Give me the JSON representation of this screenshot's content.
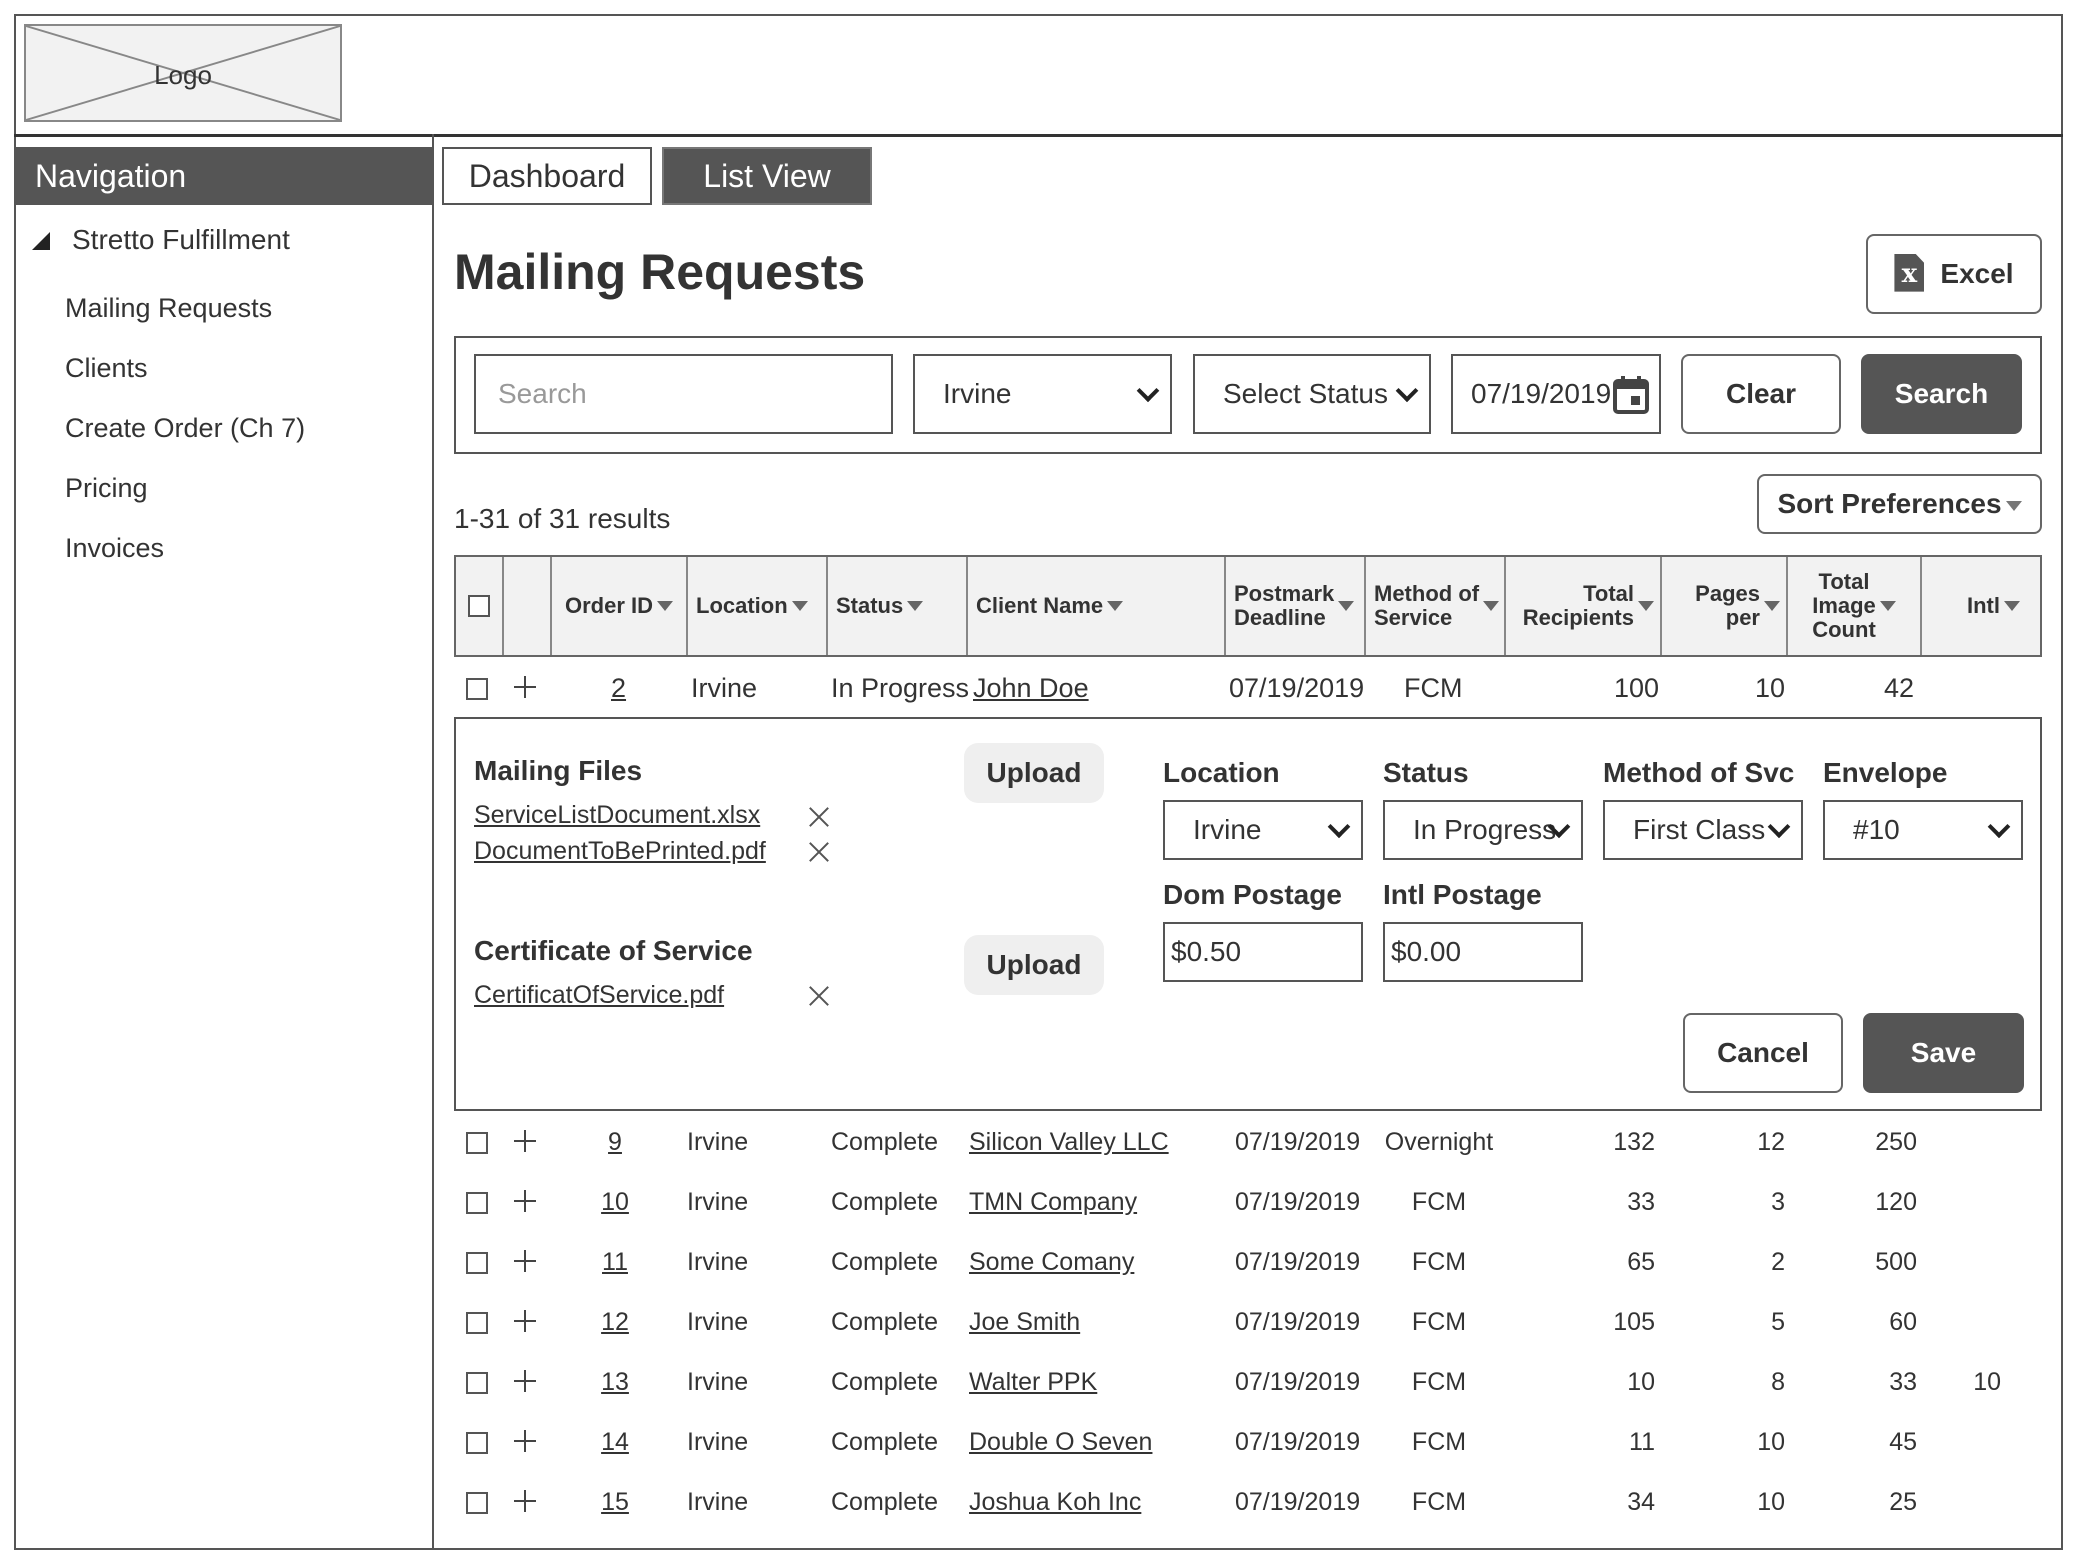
{
  "logo": {
    "text": "Logo"
  },
  "nav": {
    "header": "Navigation",
    "group": "Stretto Fulfillment",
    "items": [
      "Mailing Requests",
      "Clients",
      "Create Order (Ch 7)",
      "Pricing",
      "Invoices"
    ]
  },
  "tabs": {
    "dashboard": "Dashboard",
    "list_view": "List View"
  },
  "page": {
    "title": "Mailing Requests",
    "excel_label": "Excel",
    "excel_icon_glyph": "x"
  },
  "filters": {
    "search_placeholder": "Search",
    "location": "Irvine",
    "status": "Select Status",
    "date": "07/19/2019",
    "clear_label": "Clear",
    "search_label": "Search"
  },
  "results_text": "1-31 of 31 results",
  "sort_label": "Sort Preferences",
  "columns": {
    "order_id": "Order ID",
    "location": "Location",
    "status": "Status",
    "client_name": "Client Name",
    "postmark_1": "Postmark",
    "postmark_2": "Deadline",
    "method_1": "Method of",
    "method_2": "Service",
    "recipients_1": "Total",
    "recipients_2": "Recipients",
    "pages_1": "Pages",
    "pages_2": "per",
    "image_1": "Total",
    "image_2": "Image",
    "image_3": "Count",
    "intl": "Intl"
  },
  "expanded_row": {
    "order_id": "2",
    "location": "Irvine",
    "status": "In Progress",
    "client": "John Doe",
    "deadline": "07/19/2019",
    "method": "FCM",
    "recipients": "100",
    "pages": "10",
    "images": "42"
  },
  "detail": {
    "mailing_files_label": "Mailing Files",
    "mailing_files": [
      "ServiceListDocument.xlsx",
      "DocumentToBePrinted.pdf"
    ],
    "certificate_label": "Certificate of Service",
    "certificate_files": [
      "CertificatOfService.pdf"
    ],
    "upload_label": "Upload",
    "location_label": "Location",
    "location_value": "Irvine",
    "status_label": "Status",
    "status_value": "In Progress",
    "method_label": "Method of Svc",
    "method_value": "First Class",
    "envelope_label": "Envelope",
    "envelope_value": "#10",
    "dom_postage_label": "Dom Postage",
    "dom_postage_value": "$0.50",
    "intl_postage_label": "Intl Postage",
    "intl_postage_value": "$0.00",
    "cancel_label": "Cancel",
    "save_label": "Save"
  },
  "rows": [
    {
      "id": "9",
      "location": "Irvine",
      "status": "Complete",
      "client": "Silicon Valley LLC",
      "deadline": "07/19/2019",
      "method": "Overnight",
      "recipients": "132",
      "pages": "12",
      "images": "250",
      "intl": ""
    },
    {
      "id": "10",
      "location": "Irvine",
      "status": "Complete",
      "client": "TMN Company",
      "deadline": "07/19/2019",
      "method": "FCM",
      "recipients": "33",
      "pages": "3",
      "images": "120",
      "intl": ""
    },
    {
      "id": "11",
      "location": "Irvine",
      "status": "Complete",
      "client": "Some Comany",
      "deadline": "07/19/2019",
      "method": "FCM",
      "recipients": "65",
      "pages": "2",
      "images": "500",
      "intl": ""
    },
    {
      "id": "12",
      "location": "Irvine",
      "status": "Complete",
      "client": "Joe Smith",
      "deadline": "07/19/2019",
      "method": "FCM",
      "recipients": "105",
      "pages": "5",
      "images": "60",
      "intl": ""
    },
    {
      "id": "13",
      "location": "Irvine",
      "status": "Complete",
      "client": "Walter PPK",
      "deadline": "07/19/2019",
      "method": "FCM",
      "recipients": "10",
      "pages": "8",
      "images": "33",
      "intl": "10"
    },
    {
      "id": "14",
      "location": "Irvine",
      "status": "Complete",
      "client": "Double O Seven",
      "deadline": "07/19/2019",
      "method": "FCM",
      "recipients": "11",
      "pages": "10",
      "images": "45",
      "intl": ""
    },
    {
      "id": "15",
      "location": "Irvine",
      "status": "Complete",
      "client": "Joshua Koh Inc",
      "deadline": "07/19/2019",
      "method": "FCM",
      "recipients": "34",
      "pages": "10",
      "images": "25",
      "intl": ""
    }
  ]
}
